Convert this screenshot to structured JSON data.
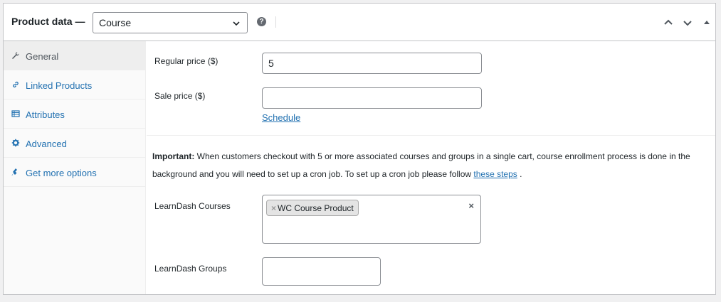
{
  "header": {
    "title": "Product data —",
    "product_type": "Course",
    "help_icon": "help-circle-icon",
    "controls": [
      "move-up-icon",
      "move-down-icon",
      "toggle-collapse-icon"
    ]
  },
  "tabs": [
    {
      "label": "General",
      "icon": "wrench-icon",
      "active": true
    },
    {
      "label": "Linked Products",
      "icon": "link-icon",
      "active": false
    },
    {
      "label": "Attributes",
      "icon": "list-table-icon",
      "active": false
    },
    {
      "label": "Advanced",
      "icon": "gear-icon",
      "active": false
    },
    {
      "label": "Get more options",
      "icon": "plugin-icon",
      "active": false
    }
  ],
  "general": {
    "regular_price_label": "Regular price ($)",
    "regular_price_value": "5",
    "sale_price_label": "Sale price ($)",
    "sale_price_value": "",
    "schedule_link": "Schedule"
  },
  "notice": {
    "strong": "Important:",
    "text": " When customers checkout with 5 or more associated courses and groups in a single cart, course enrollment process is done in the background and you will need to set up a cron job. To set up a cron job please follow ",
    "link": "these steps",
    "end": " ."
  },
  "learndash": {
    "courses_label": "LearnDash Courses",
    "courses_selected": [
      "WC Course Product"
    ],
    "chip_remove": "×",
    "clear_all": "×",
    "groups_label": "LearnDash Groups"
  },
  "colors": {
    "link": "#2271b1",
    "border": "#c3c4c7",
    "tab_active_bg": "#eeeeee"
  }
}
